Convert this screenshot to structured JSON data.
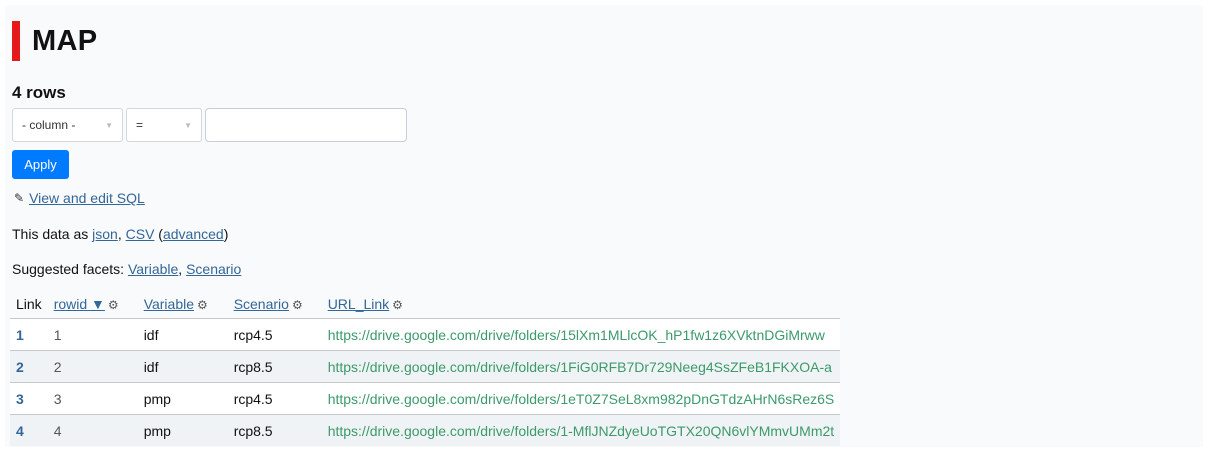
{
  "header": {
    "title": "MAP",
    "title_accent_color": "#e5191b"
  },
  "rows_count": "4 rows",
  "filter": {
    "column_select": "- column -",
    "operator_select": "=",
    "value": "",
    "apply_label": "Apply"
  },
  "sql_link": {
    "icon": "pencil-icon",
    "label": "View and edit SQL"
  },
  "export": {
    "prefix": "This data as ",
    "json": "json",
    "sep": ", ",
    "csv": "CSV",
    "open_paren": " (",
    "advanced": "advanced",
    "close_paren": ")"
  },
  "facets": {
    "prefix": "Suggested facets: ",
    "items": [
      "Variable",
      "Scenario"
    ],
    "sep": ", "
  },
  "table": {
    "columns": [
      {
        "label": "Link"
      },
      {
        "label": "rowid ▼",
        "icon": "cog-icon"
      },
      {
        "label": "Variable",
        "icon": "cog-icon"
      },
      {
        "label": "Scenario",
        "icon": "cog-icon"
      },
      {
        "label": "URL_Link",
        "icon": "cog-icon"
      }
    ],
    "rows": [
      {
        "link": "1",
        "rowid": "1",
        "variable": "idf",
        "scenario": "rcp4.5",
        "url": "https://drive.google.com/drive/folders/15lXm1MLlcOK_hP1fw1z6XVktnDGiMrww"
      },
      {
        "link": "2",
        "rowid": "2",
        "variable": "idf",
        "scenario": "rcp8.5",
        "url": "https://drive.google.com/drive/folders/1FiG0RFB7Dr729Neeg4SsZFeB1FKXOA-a"
      },
      {
        "link": "3",
        "rowid": "3",
        "variable": "pmp",
        "scenario": "rcp4.5",
        "url": "https://drive.google.com/drive/folders/1eT0Z7SeL8xm982pDnGTdzAHrN6sRez6S"
      },
      {
        "link": "4",
        "rowid": "4",
        "variable": "pmp",
        "scenario": "rcp8.5",
        "url": "https://drive.google.com/drive/folders/1-MflJNZdyeUoTGTX20QN6vlYMmvUMm2t"
      }
    ]
  },
  "colors": {
    "link": "#336699",
    "url_text": "#3c9a6b",
    "apply_button": "#007bff"
  }
}
